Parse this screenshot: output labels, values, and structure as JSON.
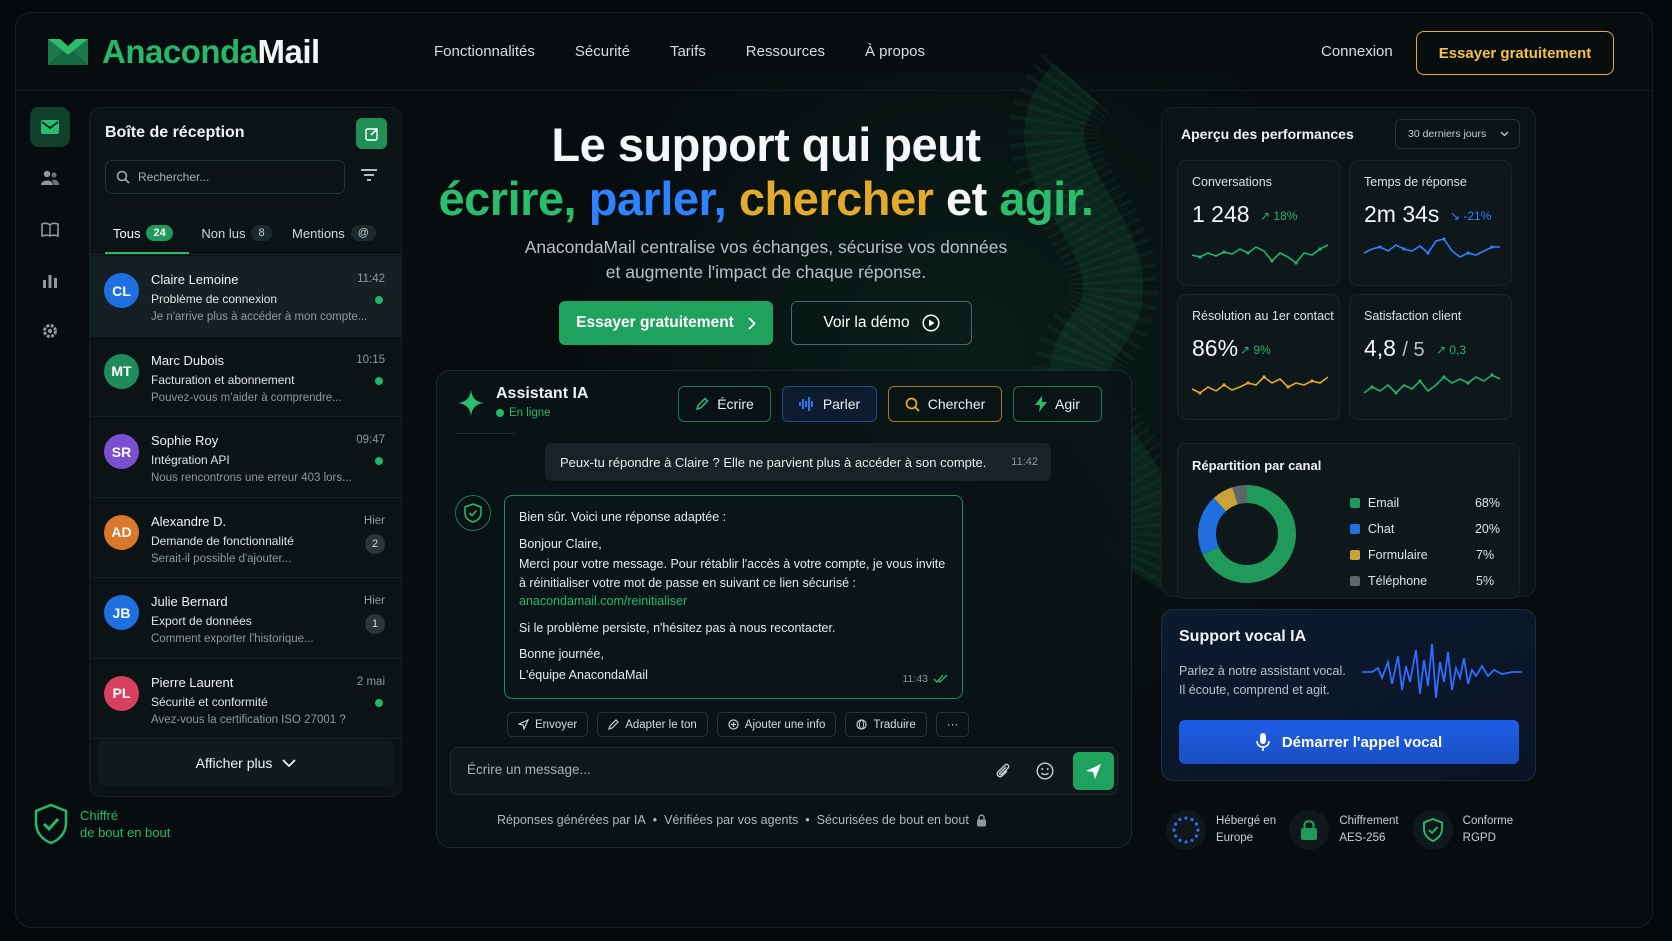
{
  "brand": {
    "part1": "Anaconda",
    "part2": "Mail",
    "accent": "#25b86b"
  },
  "nav": {
    "links": [
      "Fonctionnalités",
      "Sécurité",
      "Tarifs",
      "Ressources",
      "À propos"
    ],
    "login": "Connexion",
    "cta": "Essayer gratuitement"
  },
  "rail": {
    "icons": [
      "mail-icon",
      "contacts-icon",
      "book-icon",
      "chart-icon",
      "settings-icon"
    ]
  },
  "secure_badge": {
    "line1": "Chiffré",
    "line2": "de bout en bout"
  },
  "inbox": {
    "title": "Boîte de réception",
    "search_placeholder": "Rechercher...",
    "tabs": [
      {
        "label": "Tous",
        "count": "24"
      },
      {
        "label": "Non lus",
        "count": "8"
      },
      {
        "label": "Mentions",
        "count": "@"
      }
    ],
    "messages": [
      {
        "initials": "CL",
        "color": "#1f6fe0",
        "name": "Claire Lemoine",
        "subject": "Problème de connexion",
        "preview": "Je n'arrive plus à accéder à mon compte...",
        "time": "11:42",
        "unread_dot": true
      },
      {
        "initials": "MT",
        "color": "#1f8a5b",
        "name": "Marc Dubois",
        "subject": "Facturation et abonnement",
        "preview": "Pouvez-vous m'aider à comprendre...",
        "time": "10:15",
        "unread_dot": true
      },
      {
        "initials": "SR",
        "color": "#7b4fd0",
        "name": "Sophie Roy",
        "subject": "Intégration API",
        "preview": "Nous rencontrons une erreur 403 lors...",
        "time": "09:47",
        "unread_dot": true
      },
      {
        "initials": "AD",
        "color": "#d9772a",
        "name": "Alexandre D.",
        "subject": "Demande de fonctionnalité",
        "preview": "Serait-il possible d'ajouter...",
        "time": "Hier",
        "count": "2"
      },
      {
        "initials": "JB",
        "color": "#1f6fe0",
        "name": "Julie Bernard",
        "subject": "Export de données",
        "preview": "Comment exporter l'historique...",
        "time": "Hier",
        "count": "1"
      },
      {
        "initials": "PL",
        "color": "#d8405f",
        "name": "Pierre Laurent",
        "subject": "Sécurité et conformité",
        "preview": "Avez-vous la certification ISO 27001 ?",
        "time": "2 mai",
        "unread_dot": true
      }
    ],
    "show_more": "Afficher plus"
  },
  "hero": {
    "line1": "Le support qui peut",
    "w1": "écrire,",
    "w2": "parler,",
    "w3": "chercher",
    "w4": "et",
    "w5": "agir.",
    "sub1": "AnacondaMail centralise vos échanges, sécurise vos données",
    "sub2": "et augmente l'impact de chaque réponse.",
    "cta_primary": "Essayer gratuitement",
    "cta_secondary": "Voir la démo"
  },
  "assistant": {
    "title": "Assistant IA",
    "status": "En ligne",
    "modes": [
      "Écrire",
      "Parler",
      "Chercher",
      "Agir"
    ],
    "user_message": "Peux-tu répondre à Claire ? Elle ne parvient plus à accéder à son compte.",
    "user_time": "11:42",
    "reply": {
      "intro": "Bien sûr. Voici une réponse adaptée :",
      "greeting": "Bonjour Claire,",
      "body": "Merci pour votre message. Pour rétablir l'accès à votre compte, je vous invite à réinitialiser votre mot de passe en suivant ce lien sécurisé :",
      "link": "anacondamail.com/reinitialiser",
      "followup": "Si le problème persiste, n'hésitez pas à nous recontacter.",
      "closing": "Bonne journée,",
      "signature": "L'équipe AnacondaMail",
      "time": "11:43"
    },
    "actions": [
      "Envoyer",
      "Adapter le ton",
      "Ajouter une info",
      "Traduire",
      "···"
    ],
    "composer_placeholder": "Écrire un message...",
    "footer": [
      "Réponses générées par IA",
      "•",
      "Vérifiées par vos agents",
      "•",
      "Sécurisées de bout en bout"
    ]
  },
  "performance": {
    "title": "Aperçu des performances",
    "period": "30 derniers jours",
    "cards": [
      {
        "label": "Conversations",
        "value": "1 248",
        "delta": "↗ 18%",
        "color": "#22b469"
      },
      {
        "label": "Temps de réponse",
        "value": "2m 34s",
        "delta": "↘ -21%",
        "color": "#2f82ff"
      },
      {
        "label": "Résolution au 1er contact",
        "value": "86%",
        "delta": "↗ 9%",
        "color": "#22b469",
        "line_color": "#e3aa2c"
      },
      {
        "label": "Satisfaction client",
        "value": "4,8",
        "value_suffix": "/ 5",
        "delta": "↗ 0,3",
        "color": "#22b469"
      }
    ],
    "channels": {
      "title": "Répartition par canal",
      "items": [
        {
          "name": "Email",
          "pct": "68%",
          "value": 68,
          "color": "#1f9a5a"
        },
        {
          "name": "Chat",
          "pct": "20%",
          "value": 20,
          "color": "#1f6fe0"
        },
        {
          "name": "Formulaire",
          "pct": "7%",
          "value": 7,
          "color": "#c9a23a"
        },
        {
          "name": "Téléphone",
          "pct": "5%",
          "value": 5,
          "color": "#5d6669"
        }
      ]
    }
  },
  "vocal": {
    "title": "Support vocal IA",
    "line1": "Parlez à notre assistant vocal.",
    "line2": "Il écoute, comprend et agit.",
    "button": "Démarrer l'appel vocal"
  },
  "footer_badges": [
    {
      "l1": "Hébergé en",
      "l2": "Europe",
      "icon": "eu-stars-icon"
    },
    {
      "l1": "Chiffrement",
      "l2": "AES-256",
      "icon": "lock-icon"
    },
    {
      "l1": "Conforme",
      "l2": "RGPD",
      "icon": "shield-check-icon"
    }
  ]
}
